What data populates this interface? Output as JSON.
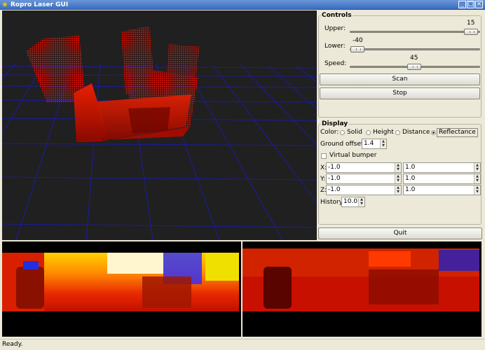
{
  "window": {
    "title": "Ropro Laser GUI"
  },
  "controls": {
    "title": "Controls",
    "upper": {
      "label": "Upper:",
      "value": "15",
      "fraction": 0.97
    },
    "lower": {
      "label": "Lower:",
      "value": "-40",
      "fraction": 0.03
    },
    "speed": {
      "label": "Speed:",
      "value": "45",
      "fraction": 0.45
    },
    "scan_label": "Scan",
    "stop_label": "Stop"
  },
  "display": {
    "title": "Display",
    "color_label": "Color:",
    "color_options": [
      "Solid",
      "Height",
      "Distance",
      "Reflectance"
    ],
    "color_selected": "Reflectance",
    "ground_offset_label": "Ground offset:",
    "ground_offset": "1.4",
    "virtual_bumper_label": "Virtual bumper",
    "virtual_bumper_checked": false,
    "x_label": "X:",
    "x_min": "-1.0",
    "x_max": "1.0",
    "y_label": "Y:",
    "y_min": "-1.0",
    "y_max": "1.0",
    "z_label": "Z:",
    "z_min": "-1.0",
    "z_max": "1.0",
    "history_label": "History:",
    "history": "10.0"
  },
  "quit_label": "Quit",
  "status": "Ready.",
  "colors": {
    "grid": "#1a1aa8",
    "point_cloud": "#e01000",
    "background": "#202020"
  }
}
